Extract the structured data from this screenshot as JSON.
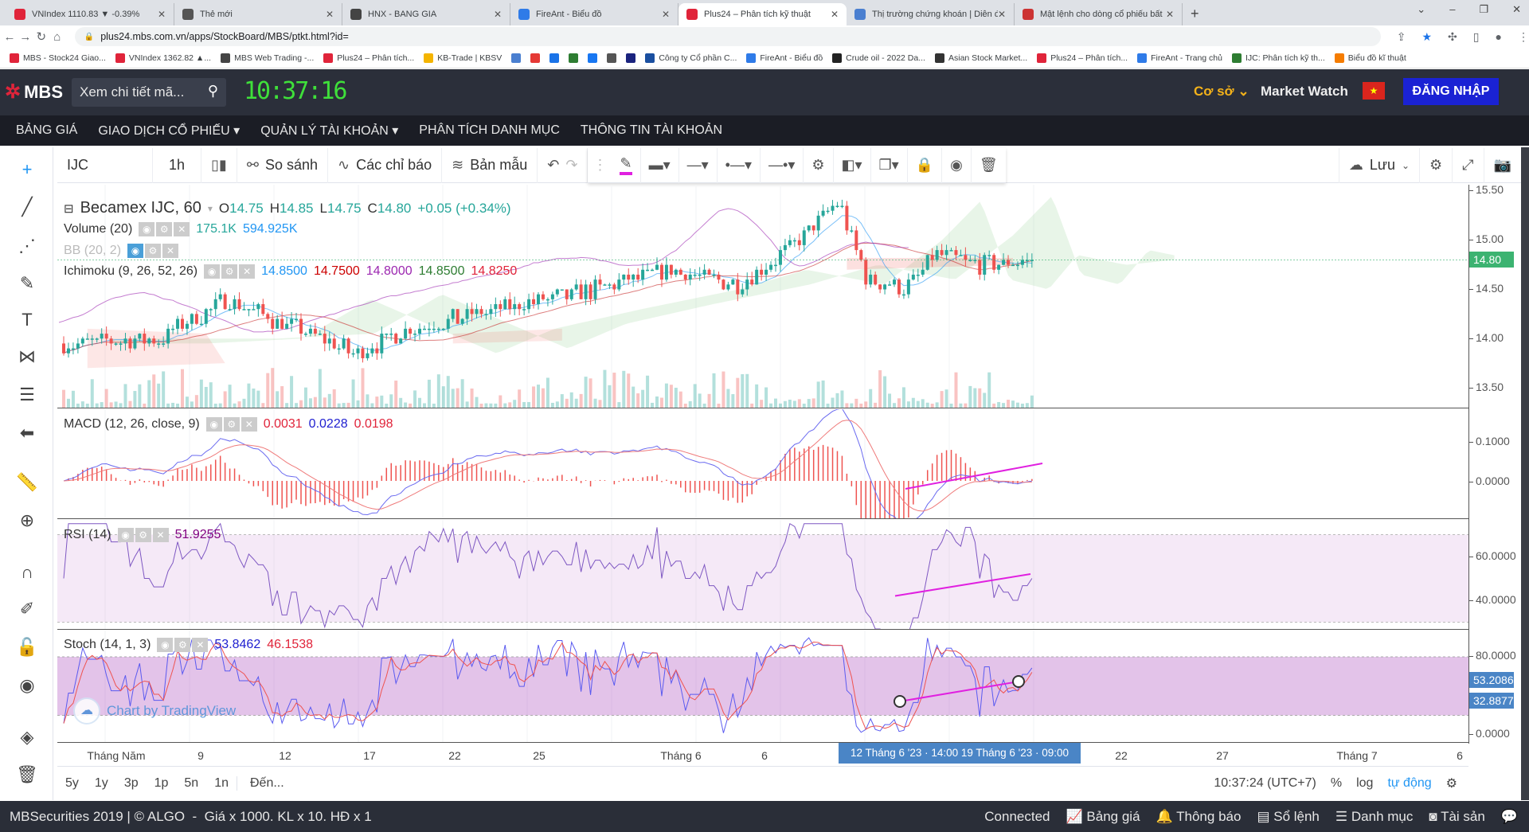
{
  "browser": {
    "tabs": [
      {
        "title": "VNIndex 1110.83 ▼ -0.39%",
        "color": "#e0243a"
      },
      {
        "title": "Thẻ mới",
        "color": "#555"
      },
      {
        "title": "HNX - BANG GIA",
        "color": "#444"
      },
      {
        "title": "FireAnt - Biểu đồ",
        "color": "#2f7be8"
      },
      {
        "title": "Plus24 – Phân tích kỹ thuật",
        "color": "#e0243a"
      },
      {
        "title": "Thị trường chứng khoán | Diễn đ",
        "color": "#4a7fd0"
      },
      {
        "title": "Mật lệnh cho dòng cổ phiếu bất",
        "color": "#c33"
      }
    ],
    "active_tab": 4,
    "url": "plus24.mbs.com.vn/apps/StockBoard/MBS/ptkt.html?id=",
    "bookmarks": [
      {
        "label": "MBS - Stock24 Giao...",
        "color": "#e0243a"
      },
      {
        "label": "VNIndex 1362.82 ▲...",
        "color": "#e0243a"
      },
      {
        "label": "MBS Web Trading -...",
        "color": "#444"
      },
      {
        "label": "Plus24 – Phân tích...",
        "color": "#e0243a"
      },
      {
        "label": "KB-Trade | KBSV",
        "color": "#f4b400"
      },
      {
        "label": "",
        "color": "#4a7fd0"
      },
      {
        "label": "",
        "color": "#e53935"
      },
      {
        "label": "",
        "color": "#1a73e8"
      },
      {
        "label": "",
        "color": "#2e7d32"
      },
      {
        "label": "",
        "color": "#1877f2"
      },
      {
        "label": "",
        "color": "#555"
      },
      {
        "label": "",
        "color": "#1a237e"
      },
      {
        "label": "Công ty Cổ phần C...",
        "color": "#1a4fa0"
      },
      {
        "label": "FireAnt - Biểu đồ",
        "color": "#2f7be8"
      },
      {
        "label": "Crude oil - 2022 Da...",
        "color": "#222"
      },
      {
        "label": "Asian Stock Market...",
        "color": "#333"
      },
      {
        "label": "Plus24 – Phân tích...",
        "color": "#e0243a"
      },
      {
        "label": "FireAnt - Trang chủ",
        "color": "#2f7be8"
      },
      {
        "label": "IJC: Phân tích kỹ th...",
        "color": "#2e7d32"
      },
      {
        "label": "Biểu đồ kĩ thuật",
        "color": "#f57c00"
      }
    ]
  },
  "header": {
    "logo": "MBS",
    "search_placeholder": "Xem chi tiết mã...",
    "clock": "10:37:16",
    "market": "Cơ sở",
    "market_watch": "Market Watch",
    "login": "ĐĂNG NHẬP"
  },
  "nav": [
    "BẢNG GIÁ",
    "GIAO DỊCH CỔ PHIẾU ▾",
    "QUẢN LÝ TÀI KHOẢN ▾",
    "PHÂN TÍCH DANH MỤC",
    "THÔNG TIN TÀI KHOẢN"
  ],
  "toolbar": {
    "symbol": "IJC",
    "interval": "1h",
    "compare": "So sánh",
    "indicators": "Các chỉ báo",
    "templates": "Bản mẫu",
    "save": "Lưu"
  },
  "chart": {
    "title": "Becamex IJC, 60",
    "ohlc": {
      "o": "14.75",
      "h": "14.85",
      "l": "14.75",
      "c": "14.80",
      "change": "+0.05 (+0.34%)"
    },
    "volume": {
      "label": "Volume (20)",
      "v1": "175.1K",
      "v2": "594.925K"
    },
    "bb": {
      "label": "BB (20, 2)"
    },
    "ichimoku": {
      "label": "Ichimoku (9, 26, 52, 26)",
      "values": [
        "14.8500",
        "14.7500",
        "14.8000",
        "14.8500",
        "14.8250"
      ]
    },
    "macd": {
      "label": "MACD (12, 26, close, 9)",
      "values": [
        "0.0031",
        "0.0228",
        "0.0198"
      ]
    },
    "rsi": {
      "label": "RSI (14)",
      "value": "51.9255"
    },
    "stoch": {
      "label": "Stoch (14, 1, 3)",
      "values": [
        "53.8462",
        "46.1538"
      ]
    },
    "price_axis": [
      "15.50",
      "15.00",
      "14.50",
      "14.00",
      "13.50"
    ],
    "last_price": "14.80",
    "macd_axis": [
      "0.1000",
      "0.0000"
    ],
    "rsi_axis": [
      "60.0000",
      "40.0000"
    ],
    "stoch_axis": [
      "80.0000",
      "0.0000"
    ],
    "stoch_tags": [
      "53.2086",
      "32.8877"
    ],
    "time_axis": [
      "Tháng Năm",
      "9",
      "12",
      "17",
      "22",
      "25",
      "Tháng 6",
      "6",
      "22",
      "27",
      "Tháng 7",
      "6"
    ],
    "time_selection": "12 Tháng 6 '23 · 14:00   19 Tháng 6 '23 · 09:00",
    "watermark": "Chart by TradingView",
    "colors": {
      "up": "#26a69a",
      "down": "#ef5350",
      "macd": "#2962ff",
      "signal": "#e0243a",
      "trend": "#e020e0",
      "last_tag": "#3cb371",
      "stoch_tag": "#4a85c6"
    }
  },
  "range": {
    "buttons": [
      "5y",
      "1y",
      "3p",
      "1p",
      "5n",
      "1n"
    ],
    "goto": "Đến...",
    "time": "10:37:24 (UTC+7)",
    "percent": "%",
    "log": "log",
    "auto": "tự động"
  },
  "footer": {
    "left": "MBSecurities 2019 | © ALGO  -  Giá x 1000. KL x 10. HĐ x 1",
    "connected": "Connected",
    "items": [
      "Bảng giá",
      "Thông báo",
      "Sổ lệnh",
      "Danh mục",
      "Tài sản"
    ]
  }
}
